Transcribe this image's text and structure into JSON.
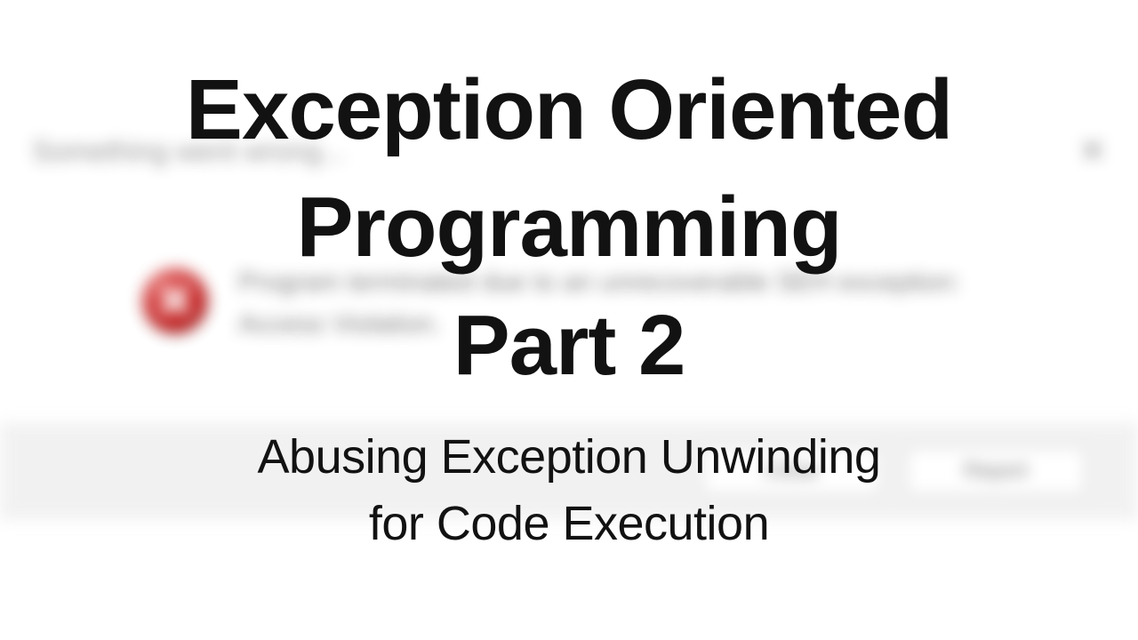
{
  "bg": {
    "title": "Something went wrong...",
    "close_glyph": "✕",
    "message_line1": "Program terminated due to an unrecoverable SEH exception:",
    "message_line2": "Access Violation.",
    "button1": "Close",
    "button2": "Report"
  },
  "fg": {
    "title_line1": "Exception Oriented",
    "title_line2": "Programming",
    "title_line3": "Part 2",
    "sub_line1": "Abusing Exception Unwinding",
    "sub_line2": "for Code Execution"
  }
}
